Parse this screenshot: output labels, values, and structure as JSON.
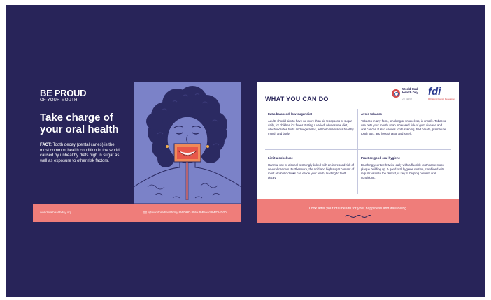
{
  "colors": {
    "frame_background": "#282459",
    "coral_footer": "#ef7d7a",
    "illustration_background": "#7b82c8",
    "navy_text": "#282459"
  },
  "left_card": {
    "brand_line1": "BE PROUD",
    "brand_line2": "OF YOUR MOUTH",
    "headline": "Take charge of your oral health",
    "fact_label": "FACT:",
    "fact_text": "Tooth decay (dental caries) is the most common health condition in the world, caused by unhealthy diets high in sugar as well as exposure to other risk factors.",
    "footer_website": "worldoralhealthday.org",
    "footer_social": "@worldoralhealthday   #WOHD #MouthProud #WOHD20",
    "icons": [
      "mail-icon"
    ]
  },
  "right_card": {
    "title": "WHAT YOU CAN DO",
    "logo1_name": "World Oral Health Day",
    "logo1_date": "20 March",
    "logo2_name": "fdi",
    "logo2_sub": "FDI World Dental Federation",
    "tips": [
      {
        "heading": "Eat a balanced, low-sugar diet",
        "body": "Adults should aim to have no more than six teaspoons of sugar daily, for children it's fewer. Eating a varied, wholesome diet, which includes fruits and vegetables, will help maintain a healthy mouth and body."
      },
      {
        "heading": "Avoid tobacco",
        "body": "Tobacco in any form, smoking or smokeless, is unsafe. Tobacco use puts your mouth at an increased risk of gum disease and oral cancer. It also causes tooth staining, bad breath, premature tooth loss, and loss of taste and smell."
      },
      {
        "heading": "Limit alcohol use",
        "body": "Harmful use of alcohol is strongly linked with an increased risk of several cancers. Furthermore, the acid and high sugar content of most alcoholic drinks can erode your teeth, leading to tooth decay."
      },
      {
        "heading": "Practice good oral hygiene",
        "body": "Brushing your teeth twice daily with a fluoride toothpaste stops plaque building up. A good oral hygiene routine, combined with regular visits to the dentist, is key to helping prevent oral conditions."
      }
    ],
    "footer_tagline": "Look after your oral health for your happiness and well-being"
  }
}
